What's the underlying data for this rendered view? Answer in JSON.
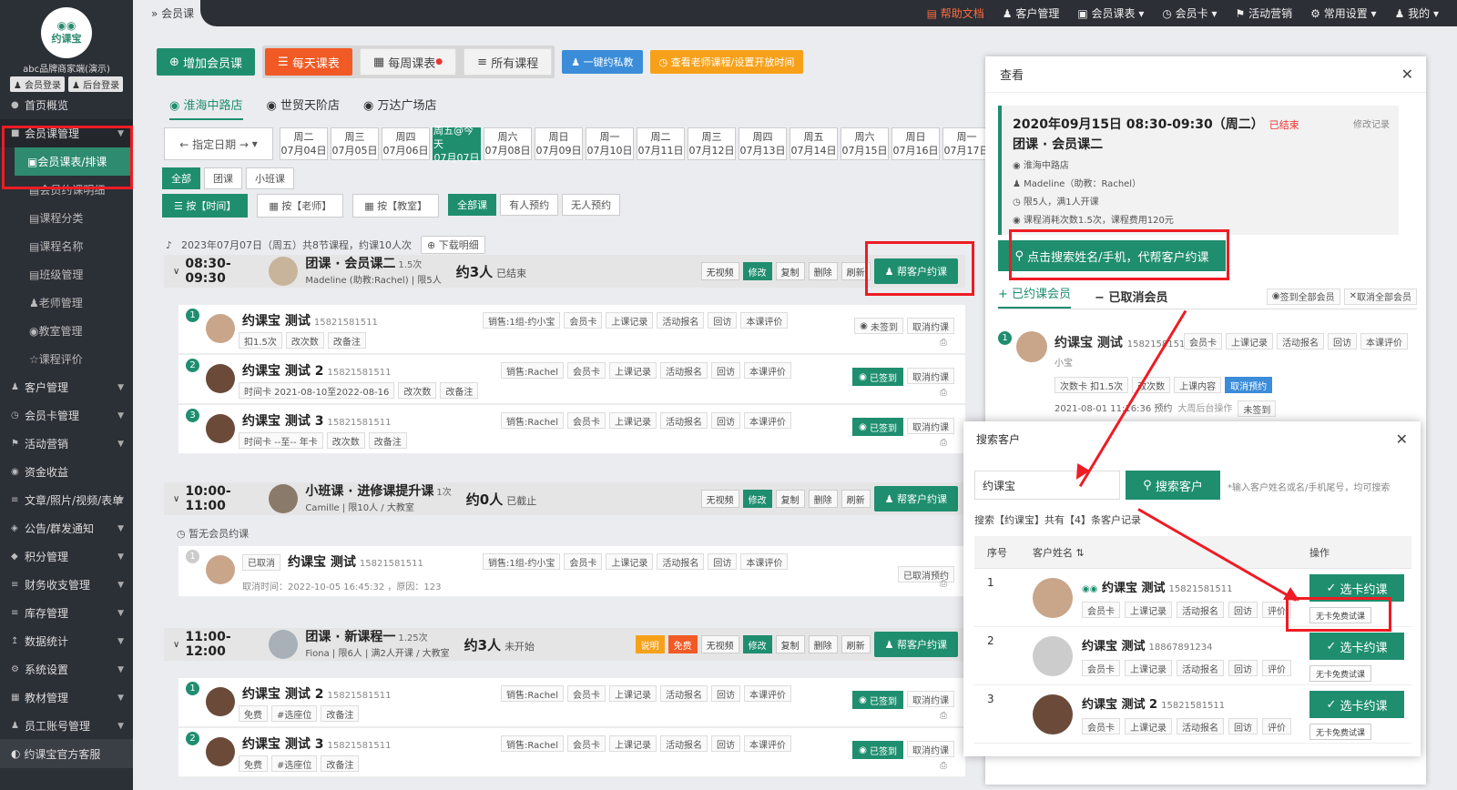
{
  "sidebar": {
    "logo_text": "约课宝",
    "brand": "abc品牌商家端(演示)",
    "member_login": "会员登录",
    "admin_login": "后台登录",
    "items": [
      {
        "label": "首页概览",
        "icon": "home-icon"
      },
      {
        "label": "会员课管理",
        "icon": "member-icon"
      },
      {
        "label": "会员课表/排课",
        "icon": "schedule-icon"
      },
      {
        "label": "会员约课明细",
        "icon": "list-icon"
      },
      {
        "label": "课程分类",
        "icon": "list-icon"
      },
      {
        "label": "课程名称",
        "icon": "list-icon"
      },
      {
        "label": "班级管理",
        "icon": "list-icon"
      },
      {
        "label": "老师管理",
        "icon": "teacher-icon"
      },
      {
        "label": "教室管理",
        "icon": "location-icon"
      },
      {
        "label": "课程评价",
        "icon": "star-icon"
      },
      {
        "label": "客户管理",
        "icon": "user-icon"
      },
      {
        "label": "会员卡管理",
        "icon": "card-icon"
      },
      {
        "label": "活动营销",
        "icon": "flag-icon"
      },
      {
        "label": "资金收益",
        "icon": "money-icon"
      },
      {
        "label": "文章/照片/视频/表单",
        "icon": "doc-icon"
      },
      {
        "label": "公告/群发通知",
        "icon": "notice-icon"
      },
      {
        "label": "积分管理",
        "icon": "points-icon"
      },
      {
        "label": "财务收支管理",
        "icon": "finance-icon"
      },
      {
        "label": "库存管理",
        "icon": "stock-icon"
      },
      {
        "label": "数据统计",
        "icon": "stats-icon"
      },
      {
        "label": "系统设置",
        "icon": "settings-icon"
      },
      {
        "label": "教材管理",
        "icon": "book-icon"
      },
      {
        "label": "员工账号管理",
        "icon": "staff-icon"
      }
    ],
    "bottom": "约课宝官方客服"
  },
  "topbar": {
    "help": "帮助文档",
    "items": [
      "客户管理",
      "会员课表",
      "会员卡",
      "活动营销",
      "常用设置",
      "我的"
    ]
  },
  "breadcrumb": "会员课",
  "toolbar": {
    "add": "增加会员课",
    "daily": "每天课表",
    "weekly": "每周课表",
    "all": "所有课程",
    "private": "一键约私教",
    "open_time": "查看老师课程/设置开放时间"
  },
  "stores": [
    "淮海中路店",
    "世贸天阶店",
    "万达广场店"
  ],
  "date_picker": "← 指定日期 →",
  "days": [
    {
      "w": "周二",
      "d": "07月04日"
    },
    {
      "w": "周三",
      "d": "07月05日"
    },
    {
      "w": "周四",
      "d": "07月06日"
    },
    {
      "w": "周五@今天",
      "d": "07月07日"
    },
    {
      "w": "周六",
      "d": "07月08日"
    },
    {
      "w": "周日",
      "d": "07月09日"
    },
    {
      "w": "周一",
      "d": "07月10日"
    },
    {
      "w": "周二",
      "d": "07月11日"
    },
    {
      "w": "周三",
      "d": "07月12日"
    },
    {
      "w": "周四",
      "d": "07月13日"
    },
    {
      "w": "周五",
      "d": "07月14日"
    },
    {
      "w": "周六",
      "d": "07月15日"
    },
    {
      "w": "周日",
      "d": "07月16日"
    },
    {
      "w": "周一",
      "d": "07月17日"
    }
  ],
  "type_filters": [
    "全部",
    "团课",
    "小班课"
  ],
  "view_filters": [
    "按【时间】",
    "按【老师】",
    "按【教室】"
  ],
  "booking_filters": [
    "全部课",
    "有人预约",
    "无人预约"
  ],
  "summary": "2023年07月07日（周五）共8节课程，约课10人次",
  "download": "下载明细",
  "op_labels": {
    "video": "无视频",
    "edit": "修改",
    "copy": "复制",
    "delete": "删除",
    "refresh": "刷新",
    "help_book": "帮客户约课",
    "note": "说明",
    "free": "免费"
  },
  "student_acts": [
    "会员卡",
    "上课记录",
    "活动报名",
    "回访",
    "本课评价"
  ],
  "classes": [
    {
      "time": "08:30-09:30",
      "title": "团课 · 会员课二",
      "hours": "1.5次",
      "sub": "Madeline (助教:Rachel) | 限5人",
      "count": "约3人",
      "status": "已结束"
    },
    {
      "time": "10:00-11:00",
      "title": "小班课 · 进修课提升课",
      "hours": "1次",
      "sub": "Camille | 限10人 / 大教室",
      "count": "约0人",
      "status": "已截止"
    },
    {
      "time": "11:00-12:00",
      "title": "团课 · 新课程一",
      "hours": "1.25次",
      "sub": "Fiona | 限6人 | 满2人开课 / 大教室",
      "count": "约3人",
      "status": "未开始"
    }
  ],
  "students": [
    {
      "n": "1",
      "name": "约课宝 测试",
      "phone": "15821581511",
      "sales": "销售:1组-约小宝",
      "tags": [
        "扣1.5次",
        "改次数",
        "改备注"
      ],
      "state": "未签到",
      "cancel": "取消约课"
    },
    {
      "n": "2",
      "name": "约课宝 测试 2",
      "phone": "15821581511",
      "sales": "销售:Rachel",
      "tags": [
        "时间卡 2021-08-10至2022-08-16",
        "改次数",
        "改备注"
      ],
      "state": "已签到",
      "cancel": "取消约课"
    },
    {
      "n": "3",
      "name": "约课宝 测试 3",
      "phone": "15821581511",
      "sales": "销售:Rachel",
      "tags": [
        "时间卡 --至-- 年卡",
        "改次数",
        "改备注"
      ],
      "state": "已签到",
      "cancel": "取消约课"
    },
    {
      "n": "1",
      "name": "约课宝 测试",
      "phone": "15821581511",
      "sales": "销售:1组-约小宝",
      "tags": [
        "取消时间：2022-10-05 16:45:32 ，原因：123"
      ],
      "state": "",
      "cancel": "已取消预约",
      "prefix": "已取消"
    },
    {
      "n": "1",
      "name": "约课宝 测试 2",
      "phone": "15821581511",
      "sales": "销售:Rachel",
      "tags": [
        "免费",
        "#选座位",
        "改备注"
      ],
      "state": "已签到",
      "cancel": "取消约课"
    },
    {
      "n": "2",
      "name": "约课宝 测试 3",
      "phone": "15821581511",
      "sales": "销售:Rachel",
      "tags": [
        "免费",
        "#选座位",
        "改备注"
      ],
      "state": "已签到",
      "cancel": "取消约课"
    }
  ],
  "no_booking": "暂无会员约课",
  "panel": {
    "title": "查看",
    "date": "2020年09月15日 08:30-09:30（周二）",
    "ended": "已结束",
    "edit_log": "修改记录",
    "cls": "团课 · 会员课二",
    "store": "淮海中路店",
    "teacher": "Madeline（助教：Rachel）",
    "limit": "限5人，满1人开课",
    "fee": "课程消耗次数1.5次，课程费用120元",
    "cta": "点击搜索姓名/手机，代帮客户约课",
    "tab_booked": "+ 已约课会员",
    "tab_cancelled": "− 已取消会员",
    "sign_all": "签到全部会员",
    "cancel_all": "取消全部会员",
    "member_name": "约课宝 测试",
    "member_phone": "15821581511",
    "member_nick": "小宝",
    "member_tags": [
      "次数卡 扣1.5次",
      "改次数",
      "上课内容",
      "取消预约"
    ],
    "member_time": "2021-08-01 11:16:36 预约",
    "member_op": "大周后台操作",
    "member_unsigned": "未签到",
    "member_acts": [
      "会员卡",
      "上课记录",
      "活动报名",
      "回访",
      "本课评价"
    ]
  },
  "dialog": {
    "title": "搜索客户",
    "query": "约课宝",
    "search_btn": "搜索客户",
    "hint": "*输入客户姓名或名/手机尾号，均可搜索",
    "result": "搜索【约课宝】共有【4】条客户记录",
    "col_no": "序号",
    "col_name": "客户姓名",
    "col_op": "操作",
    "row_acts": [
      "会员卡",
      "上课记录",
      "活动报名",
      "回访",
      "评价"
    ],
    "pick": "选卡约课",
    "free": "无卡免费试课",
    "rows": [
      {
        "no": "1",
        "name": "约课宝 测试",
        "phone": "15821581511"
      },
      {
        "no": "2",
        "name": "约课宝 测试",
        "phone": "18867891234"
      },
      {
        "no": "3",
        "name": "约课宝 测试 2",
        "phone": "15821581511"
      }
    ]
  }
}
